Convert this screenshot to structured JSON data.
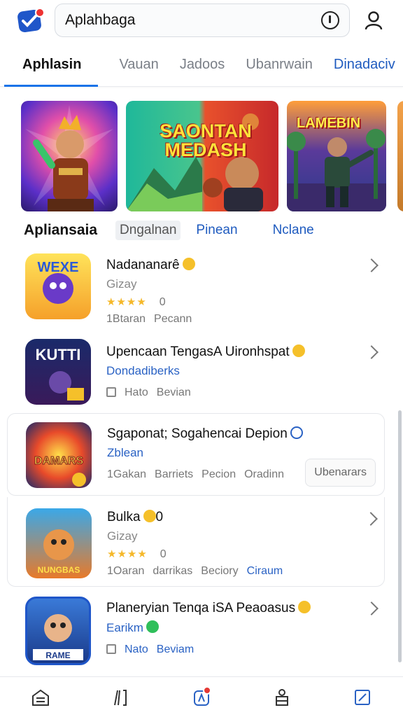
{
  "colors": {
    "accent": "#1a73e8",
    "link": "#1f5bbf",
    "star": "#f5b82a",
    "badge": "#e53935"
  },
  "header": {
    "search_text": "Aplahbaga",
    "icons": {
      "logo": "app-logo-icon",
      "info": "info-icon",
      "profile": "profile-icon"
    }
  },
  "tabs": [
    {
      "label": "Aphlasin",
      "active": true
    },
    {
      "label": "Vauan"
    },
    {
      "label": "Jadoos"
    },
    {
      "label": "Ubanrwain"
    },
    {
      "label": "Dinadaciv"
    }
  ],
  "banners": [
    {
      "title": ""
    },
    {
      "title": "SAONTAN MEDASH"
    },
    {
      "title": "LAMEBIN"
    }
  ],
  "section": {
    "title": "Apliansaia",
    "chips": [
      "Dngalnan",
      "Pinean",
      "Nclane"
    ]
  },
  "apps": [
    {
      "name": "Nadananarê",
      "sub": "Gizay",
      "stars": "★★★★",
      "rating": "0",
      "meta": [
        "1Btaran",
        "Pecann"
      ],
      "icon_text": "WEXE"
    },
    {
      "name": "Upencaan TengasA Uironhspat",
      "sub": "Dondadiberks",
      "meta": [
        "Hato",
        "Bevian"
      ],
      "icon_text": "KUTTI"
    },
    {
      "name": "Sgaponat; Sogahencai Depion",
      "sub": "Zblean",
      "meta": [
        "1Gakan",
        "Barriets",
        "Pecion",
        "Oradinn"
      ],
      "install": "Ubenarars",
      "icon_text": "DAMARS"
    },
    {
      "name": "Bulka",
      "name_suffix": "0",
      "sub": "Gizay",
      "stars": "★★★★",
      "rating": "0",
      "meta": [
        "1Oaran",
        "darrikas",
        "Beciory",
        "Ciraum"
      ],
      "icon_text": "NUNGBAS"
    },
    {
      "name": "Planeryian Tenqa iSA Peaoasus",
      "sub": "Earikm",
      "meta": [
        "Nato",
        "Beviam"
      ],
      "icon_text": "RAME"
    }
  ],
  "bottom_nav": [
    {
      "icon": "home-icon"
    },
    {
      "icon": "apps-icon"
    },
    {
      "icon": "notifications-icon",
      "badge": true
    },
    {
      "icon": "account-icon"
    },
    {
      "icon": "edit-icon"
    }
  ]
}
